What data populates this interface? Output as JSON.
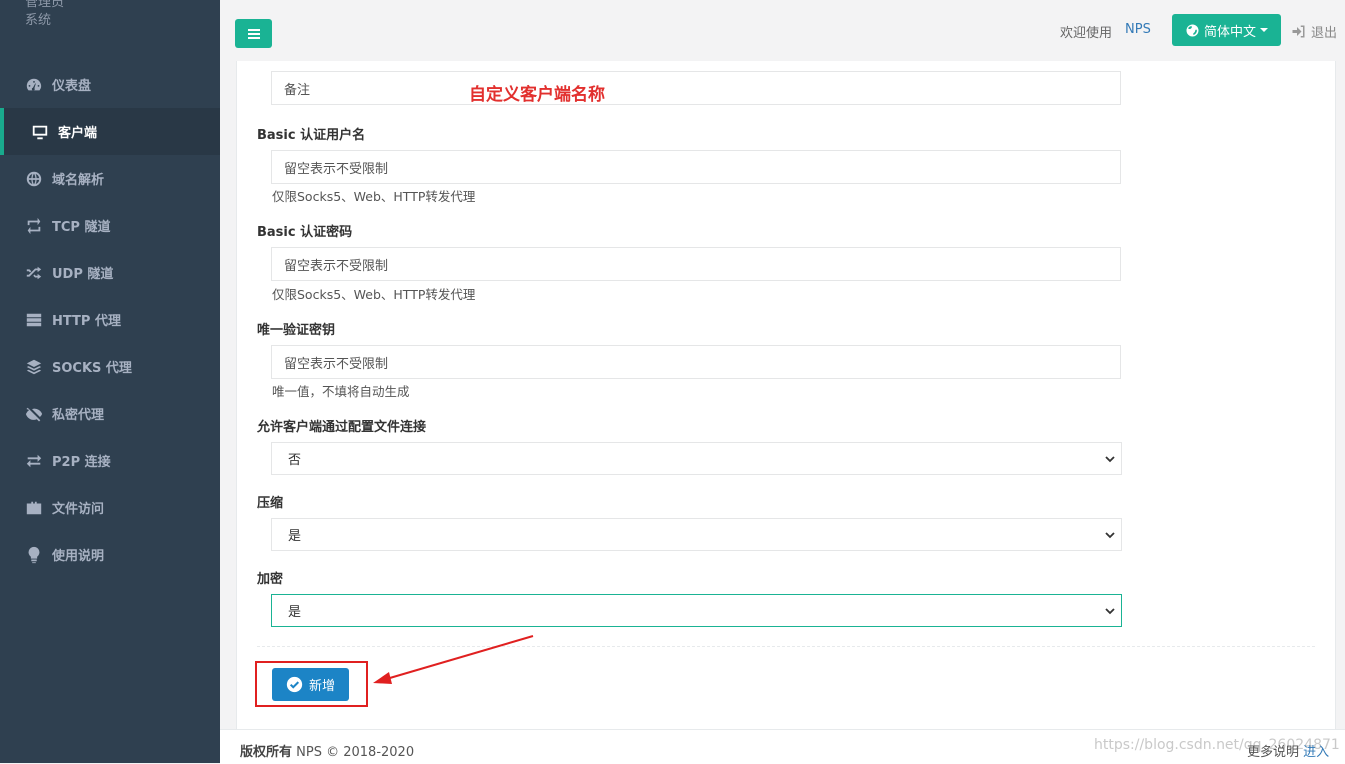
{
  "brand": {
    "line1": "管理员",
    "line2": "系统"
  },
  "sidebar": {
    "items": [
      {
        "label": "仪表盘",
        "icon": "dashboard-icon"
      },
      {
        "label": "客户端",
        "icon": "desktop-icon",
        "active": true
      },
      {
        "label": "域名解析",
        "icon": "globe-icon"
      },
      {
        "label": "TCP 隧道",
        "icon": "retweet-icon"
      },
      {
        "label": "UDP 隧道",
        "icon": "random-icon"
      },
      {
        "label": "HTTP 代理",
        "icon": "server-icon"
      },
      {
        "label": "SOCKS 代理",
        "icon": "layers-icon"
      },
      {
        "label": "私密代理",
        "icon": "eye-slash-icon"
      },
      {
        "label": "P2P 连接",
        "icon": "exchange-icon"
      },
      {
        "label": "文件访问",
        "icon": "briefcase-icon"
      },
      {
        "label": "使用说明",
        "icon": "lightbulb-icon"
      }
    ]
  },
  "topbar": {
    "welcome": "欢迎使用",
    "app_name": "NPS",
    "language": "简体中文",
    "logout": "退出"
  },
  "form": {
    "remark": {
      "placeholder": "备注"
    },
    "annotation": "自定义客户端名称",
    "basic_user": {
      "label": "Basic 认证用户名",
      "placeholder": "留空表示不受限制",
      "help": "仅限Socks5、Web、HTTP转发代理"
    },
    "basic_pass": {
      "label": "Basic 认证密码",
      "placeholder": "留空表示不受限制",
      "help": "仅限Socks5、Web、HTTP转发代理"
    },
    "vkey": {
      "label": "唯一验证密钥",
      "placeholder": "留空表示不受限制",
      "help": "唯一值，不填将自动生成"
    },
    "config_conn": {
      "label": "允许客户端通过配置文件连接",
      "value": "否"
    },
    "compress": {
      "label": "压缩",
      "value": "是"
    },
    "crypt": {
      "label": "加密",
      "value": "是"
    },
    "submit_label": "新增"
  },
  "footer": {
    "copyright_bold": "版权所有",
    "copyright_rest": "NPS © 2018-2020",
    "more_label": "更多说明",
    "more_link": "进入",
    "watermark": "https://blog.csdn.net/qq_26024871"
  },
  "colors": {
    "sidebar_bg": "#2f4050",
    "accent": "#1ab394",
    "primary": "#1c84c6",
    "annotation": "#e2302e"
  }
}
